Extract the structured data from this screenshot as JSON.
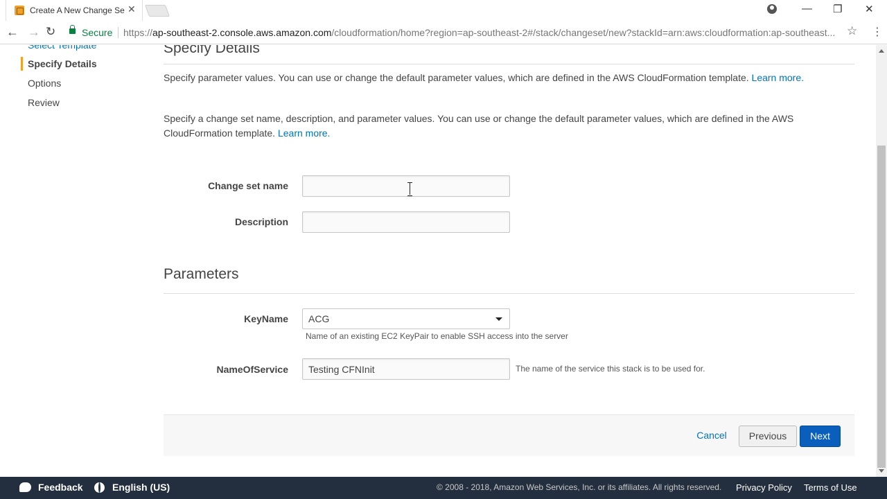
{
  "browser": {
    "tab_title": "Create A New Change Se",
    "secure_label": "Secure",
    "url_scheme": "https://",
    "url_host": "ap-southeast-2.console.aws.amazon.com",
    "url_path": "/cloudformation/home?region=ap-southeast-2#/stack/changeset/new?stackId=arn:aws:cloudformation:ap-southeast..."
  },
  "sidebar": {
    "items": [
      {
        "label": "Select Template"
      },
      {
        "label": "Specify Details"
      },
      {
        "label": "Options"
      },
      {
        "label": "Review"
      }
    ],
    "active_index": 1
  },
  "main": {
    "title": "Specify Details",
    "intro_text": "Specify parameter values. You can use or change the default parameter values, which are defined in the AWS CloudFormation template.",
    "intro_link": "Learn more.",
    "changeset_text": "Specify a change set name, description, and parameter values. You can use or change the default parameter values, which are defined in the AWS CloudFormation template.",
    "changeset_link": "Learn more.",
    "change_set_name_label": "Change set name",
    "change_set_name_value": "",
    "description_label": "Description",
    "description_value": ""
  },
  "parameters": {
    "title": "Parameters",
    "keyname_label": "KeyName",
    "keyname_value": "ACG",
    "keyname_help": "Name of an existing EC2 KeyPair to enable SSH access into the server",
    "nameofservice_label": "NameOfService",
    "nameofservice_value": "Testing CFNInit",
    "nameofservice_help": "The name of the service this stack is to be used for."
  },
  "actions": {
    "cancel": "Cancel",
    "previous": "Previous",
    "next": "Next"
  },
  "console_footer": {
    "feedback": "Feedback",
    "language": "English (US)",
    "copyright": "© 2008 - 2018, Amazon Web Services, Inc. or its affiliates. All rights reserved.",
    "privacy": "Privacy Policy",
    "terms": "Terms of Use"
  },
  "colors": {
    "accent_orange": "#f0a128",
    "link_blue": "#0073bb",
    "primary_button": "#0a5fbd",
    "footer_bg": "#232f3e"
  }
}
